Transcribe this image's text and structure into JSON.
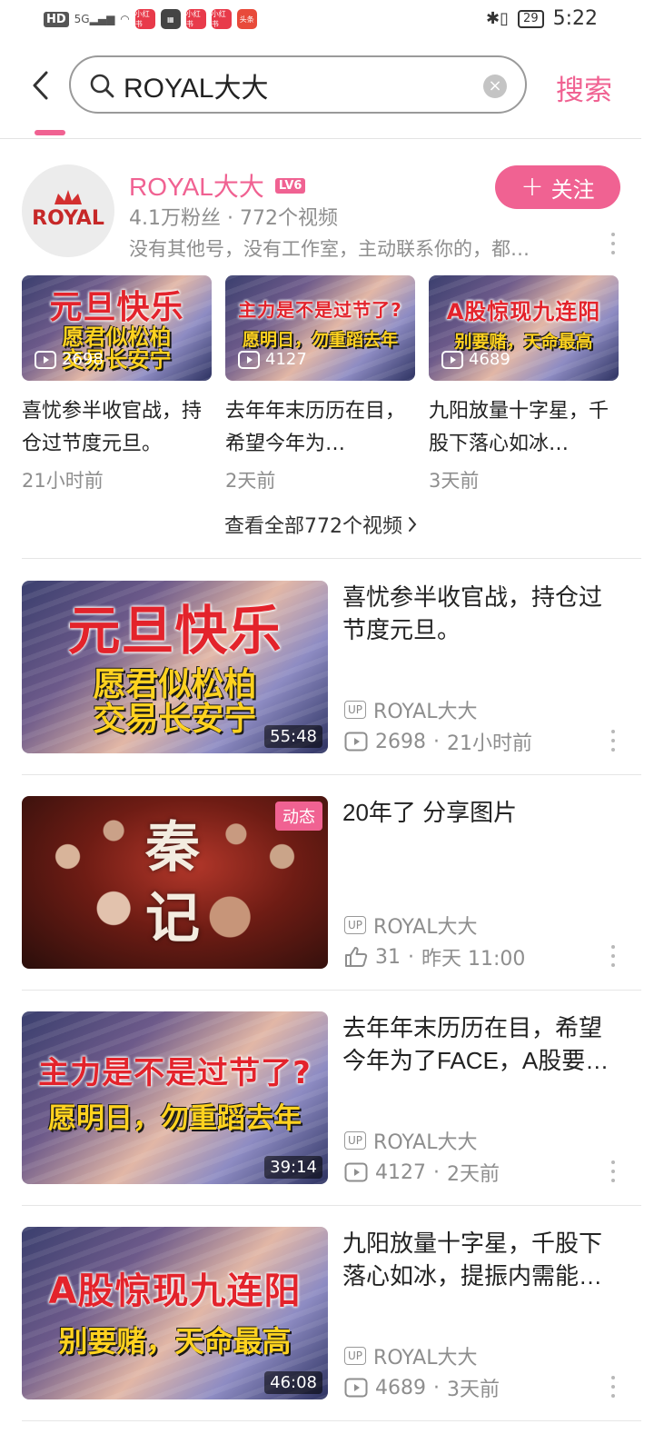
{
  "status_bar": {
    "left_badge": "HD",
    "signal": "5G",
    "app_icons": [
      "小红书",
      "",
      "小红书",
      "小红书",
      "头条"
    ],
    "battery": "29",
    "time": "5:22"
  },
  "search": {
    "query": "ROYAL大大",
    "button_label": "搜索"
  },
  "user_card": {
    "name": "ROYAL大大",
    "level": "LV6",
    "avatar_text": "ROYAL",
    "stats": "4.1万粉丝 · 772个视频",
    "description": "没有其他号，没有工作室，主动联系你的，都…",
    "follow_label": "关注"
  },
  "video_strip": [
    {
      "thumb_line1": "元旦快乐",
      "thumb_line2": "愿君似松柏\n交易长安宁",
      "plays": "2698",
      "title": "喜忧参半收官战，持仓过节度元旦。",
      "time": "21小时前"
    },
    {
      "thumb_line1": "主力是不是过节了?",
      "thumb_line2": "愿明日，勿重蹈去年",
      "plays": "4127",
      "title": "去年年末历历在目，希望今年为…",
      "time": "2天前"
    },
    {
      "thumb_line1": "A股惊现九连阳",
      "thumb_line2": "别要赌，天命最高",
      "plays": "4689",
      "title": "九阳放量十字星，千股下落心如冰…",
      "time": "3天前"
    }
  ],
  "view_all_label": "查看全部772个视频",
  "feed": [
    {
      "type": "video",
      "thumb_line1": "元旦快乐",
      "thumb_line2": "愿君似松柏\n交易长安宁",
      "duration": "55:48",
      "title": "喜忧参半收官战，持仓过节度元旦。",
      "uploader": "ROYAL大大",
      "stat": "2698",
      "time": "21小时前"
    },
    {
      "type": "dynamic",
      "poster_text": "秦记",
      "tag": "动态",
      "title": "20年了 分享图片",
      "uploader": "ROYAL大大",
      "stat": "31",
      "time": "昨天 11:00"
    },
    {
      "type": "video",
      "thumb_line1": "主力是不是过节了?",
      "thumb_line2": "愿明日，勿重蹈去年",
      "duration": "39:14",
      "title": "去年年末历历在目，希望今年为了FACE，A股要…",
      "uploader": "ROYAL大大",
      "stat": "4127",
      "time": "2天前"
    },
    {
      "type": "video",
      "thumb_line1": "A股惊现九连阳",
      "thumb_line2": "别要赌，天命最高",
      "duration": "46:08",
      "title": "九阳放量十字星，千股下落心如冰，提振内需能…",
      "uploader": "ROYAL大大",
      "stat": "4689",
      "time": "3天前"
    }
  ],
  "up_tag": "UP",
  "colors": {
    "accent": "#f06292",
    "text_secondary": "#8e8e8e"
  }
}
